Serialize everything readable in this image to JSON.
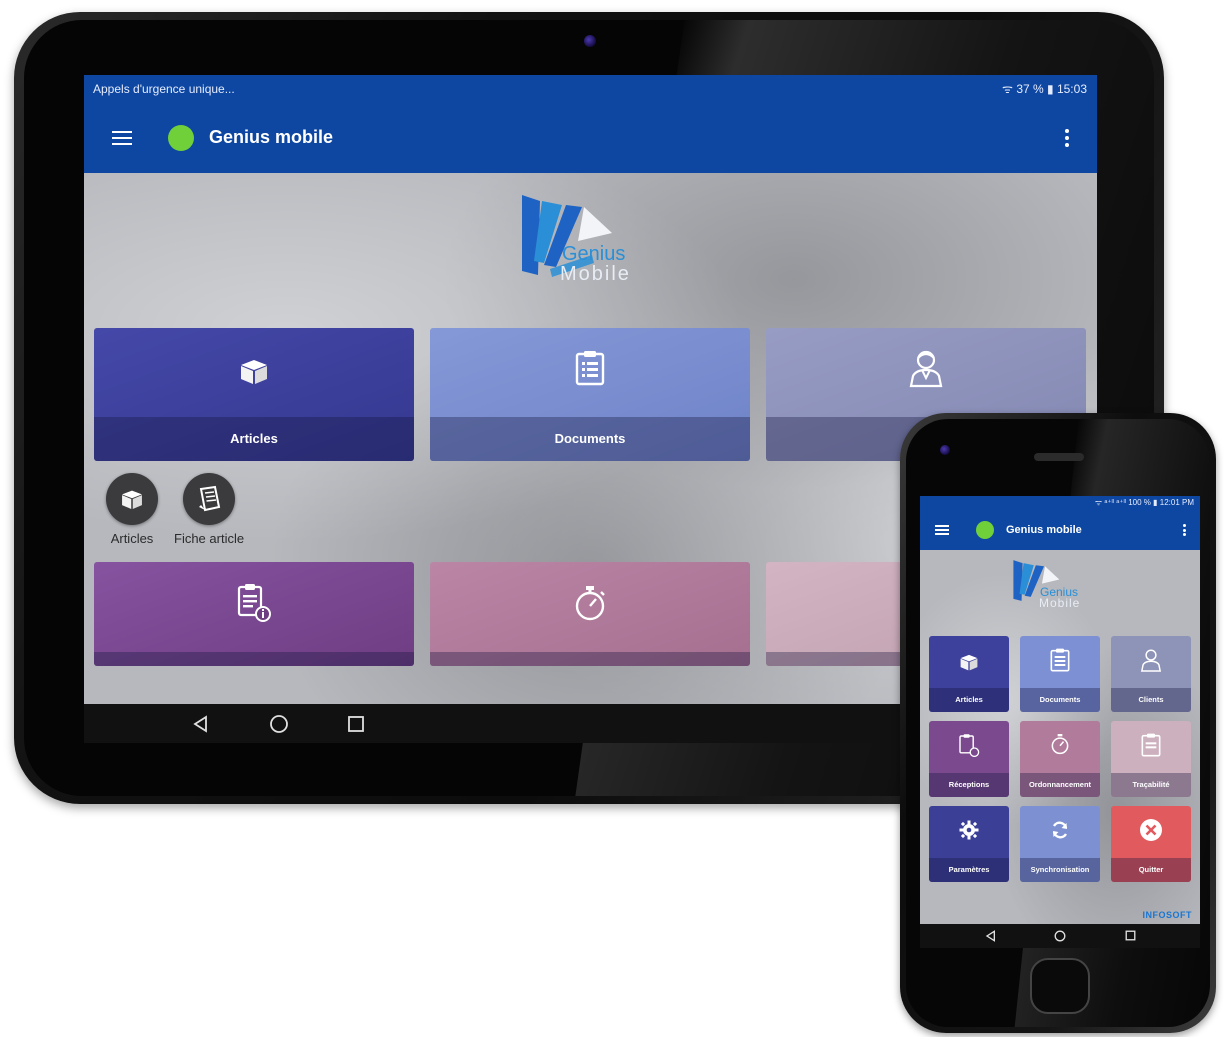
{
  "tablet": {
    "status_left": "Appels d'urgence unique...",
    "status_right": "ᯤ 37 % ▮ 15:03",
    "app_title": "Genius mobile",
    "logo": {
      "word1": "Genius",
      "word2": "Mobile"
    },
    "tiles_row1": [
      {
        "label": "Articles",
        "icon": "box-icon",
        "color": "#3b3f9c"
      },
      {
        "label": "Documents",
        "icon": "clipboard-list-icon",
        "color": "#7a8fd2"
      },
      {
        "label": "",
        "icon": "person-icon",
        "color": "#8f94bd"
      }
    ],
    "shortcuts": [
      {
        "label": "Articles",
        "icon": "box-icon"
      },
      {
        "label": "Fiche article",
        "icon": "document-icon"
      }
    ],
    "tiles_row2": [
      {
        "label": "",
        "icon": "clipboard-info-icon",
        "color": "#7c4a8f"
      },
      {
        "label": "",
        "icon": "stopwatch-icon",
        "color": "#b27a9c"
      },
      {
        "label": "",
        "icon": "",
        "color": "#c9aab8"
      }
    ]
  },
  "phone": {
    "status_right": "ᯤ ᵃ⁺ˡˡ ᵃ⁺ˡˡ 100 % ▮ 12:01 PM",
    "app_title": "Genius mobile",
    "logo": {
      "word1": "Genius",
      "word2": "Mobile"
    },
    "tiles": [
      {
        "label": "Articles",
        "icon": "box-icon",
        "color": "#3d419b"
      },
      {
        "label": "Documents",
        "icon": "clipboard-list-icon",
        "color": "#7d90d4"
      },
      {
        "label": "Clients",
        "icon": "person-icon",
        "color": "#8e93b8"
      },
      {
        "label": "Réceptions",
        "icon": "clipboard-info-icon",
        "color": "#7b4a8e"
      },
      {
        "label": "Ordonnancement",
        "icon": "stopwatch-icon",
        "color": "#b17b9c"
      },
      {
        "label": "Traçabilité",
        "icon": "clipboard-icon",
        "color": "#cdb0bd"
      },
      {
        "label": "Paramètres",
        "icon": "gear-icon",
        "color": "#3b3f96"
      },
      {
        "label": "Synchronisation",
        "icon": "sync-icon",
        "color": "#7c90d2"
      },
      {
        "label": "Quitter",
        "icon": "close-circle-icon",
        "color": "#e15a5e"
      }
    ],
    "brand": "INFOSOFT"
  }
}
